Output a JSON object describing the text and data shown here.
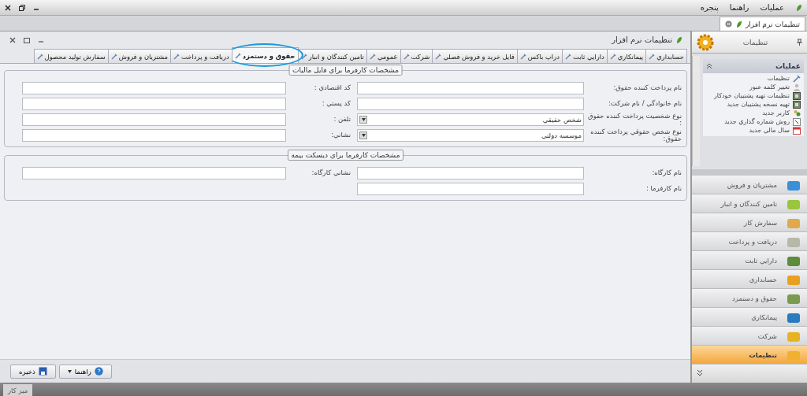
{
  "menu_bar": {
    "items": [
      "عمليات",
      "راهنما",
      "پنجره"
    ]
  },
  "document_tabs": [
    {
      "label": "تنظيمات نرم افزار",
      "selected": true
    }
  ],
  "window": {
    "title": "تنظيمات نرم افزار"
  },
  "tabs": [
    {
      "label": "حسابداري",
      "selected": false
    },
    {
      "label": "پيمانكاري",
      "selected": false
    },
    {
      "label": "دارايي ثابت",
      "selected": false
    },
    {
      "label": "دراپ باكس",
      "selected": false
    },
    {
      "label": "فايل خريد و فروش فصلي",
      "selected": false
    },
    {
      "label": "شركت",
      "selected": false
    },
    {
      "label": "عمومي",
      "selected": false
    },
    {
      "label": "تامين كنندگان و انبار",
      "selected": false
    },
    {
      "label": "حقوق و دستمزد",
      "selected": true
    },
    {
      "label": "دريافت و پرداخت",
      "selected": false
    },
    {
      "label": "مشتريان و فروش",
      "selected": false
    },
    {
      "label": "سفارش توليد محصول",
      "selected": false
    }
  ],
  "groups": [
    {
      "title": "مشخصات كارفرما براي فايل ماليات",
      "columns": [
        [
          {
            "label": "نام پرداخت كننده حقوق:",
            "kind": "text"
          },
          {
            "label": "نام خانوادگي / نام شركت:",
            "kind": "text"
          },
          {
            "label": "نوع شخصيت پرداخت كننده حقوق :",
            "kind": "select",
            "value": "شخص حقيقي"
          },
          {
            "label": "نوع شخص حقوقي پرداخت كننده حقوق:",
            "kind": "select",
            "value": "موسسه دولتي"
          }
        ],
        [
          {
            "label": "كد اقتصادي :",
            "kind": "text"
          },
          {
            "label": "كد پستي :",
            "kind": "text"
          },
          {
            "label": "تلفن :",
            "kind": "text"
          },
          {
            "label": "نشاني:",
            "kind": "text"
          }
        ]
      ]
    },
    {
      "title": "مشخصات كارفرما براي ديسكت بيمه",
      "columns": [
        [
          {
            "label": "نام كارگاه:",
            "kind": "text"
          },
          {
            "label": "نام كارفرما :",
            "kind": "text"
          }
        ],
        [
          {
            "label": "نشاني كارگاه:",
            "kind": "text"
          }
        ]
      ]
    }
  ],
  "buttons": [
    {
      "label": "راهنما",
      "kind": "help"
    },
    {
      "label": "ذخيره",
      "kind": "save"
    }
  ],
  "sidebar": {
    "title": "تنظيمات",
    "section": {
      "title": "عمليات",
      "expanded": true,
      "items": [
        {
          "label": "تنظيمات",
          "kind": "tools"
        },
        {
          "label": "تغيير كلمه عبور",
          "kind": "user"
        },
        {
          "label": "تنظيمات تهيه پشتيبان خودكار",
          "kind": "backup"
        },
        {
          "label": "تهيه نسخه پشتيبان جديد",
          "kind": "backup"
        },
        {
          "label": "كاربر جديد",
          "kind": "users"
        },
        {
          "label": "روش شماره گذاري جديد",
          "kind": "number"
        },
        {
          "label": "سال مالي جديد",
          "kind": "calendar"
        }
      ]
    },
    "nav": [
      {
        "label": "مشتريان و فروش",
        "selected": false,
        "color": "#3b8fd8"
      },
      {
        "label": "تامين كنندگان و انبار",
        "selected": false,
        "color": "#9bc53d"
      },
      {
        "label": "سفارش كار",
        "selected": false,
        "color": "#e0a94a"
      },
      {
        "label": "دريافت و پرداخت",
        "selected": false,
        "color": "#b8b8a8"
      },
      {
        "label": "دارايي ثابت",
        "selected": false,
        "color": "#5e8c3a"
      },
      {
        "label": "حسابداري",
        "selected": false,
        "color": "#e8a020"
      },
      {
        "label": "حقوق و دستمزد",
        "selected": false,
        "color": "#7a9a50"
      },
      {
        "label": "پيمانكاري",
        "selected": false,
        "color": "#2a7ac0"
      },
      {
        "label": "شركت",
        "selected": false,
        "color": "#e6b422"
      },
      {
        "label": "تنظيمات",
        "selected": true,
        "color": "#f0b030"
      }
    ]
  },
  "taskbar": {
    "label": "ميز كار"
  }
}
